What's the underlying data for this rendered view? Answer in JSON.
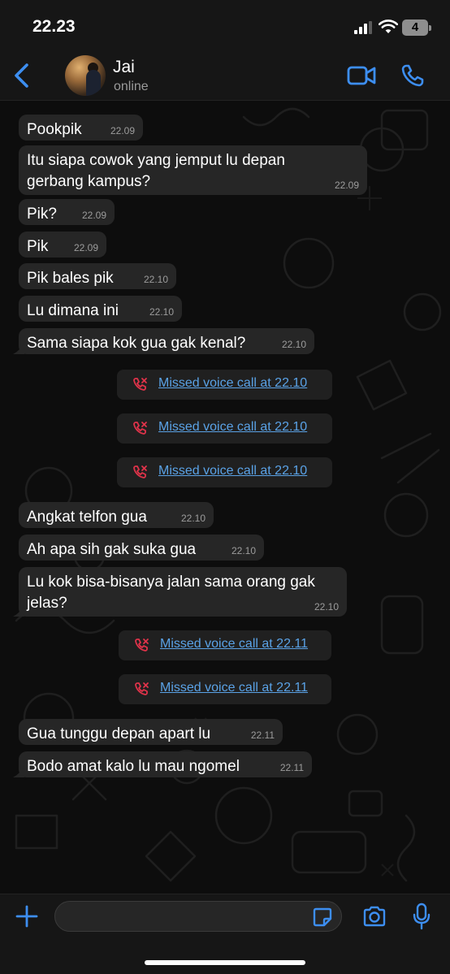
{
  "status_bar": {
    "time": "22.23",
    "battery": "4"
  },
  "header": {
    "contact_name": "Jai",
    "contact_status": "online"
  },
  "messages": [
    {
      "text": "Pookpik",
      "time": "22.09"
    },
    {
      "text": "Itu siapa cowok yang jemput lu depan\ngerbang kampus?",
      "time": "22.09"
    },
    {
      "text": "Pik?",
      "time": "22.09"
    },
    {
      "text": "Pik",
      "time": "22.09"
    },
    {
      "text": "Pik bales pik",
      "time": "22.10"
    },
    {
      "text": "Lu dimana ini",
      "time": "22.10"
    },
    {
      "text": "Sama siapa kok gua gak kenal?",
      "time": "22.10"
    },
    {
      "text": "Angkat telfon gua",
      "time": "22.10"
    },
    {
      "text": "Ah apa sih gak suka gua",
      "time": "22.10"
    },
    {
      "text": "Lu kok bisa-bisanya jalan sama orang gak\njelas?",
      "time": "22.10"
    },
    {
      "text": "Gua tunggu depan apart lu",
      "time": "22.11"
    },
    {
      "text": "Bodo amat kalo lu mau ngomel",
      "time": "22.11"
    }
  ],
  "missed_calls": [
    {
      "label": "Missed voice call at 22.10"
    },
    {
      "label": "Missed voice call at 22.10"
    },
    {
      "label": "Missed voice call at 22.10"
    },
    {
      "label": "Missed voice call at 22.11"
    },
    {
      "label": "Missed voice call at 22.11"
    }
  ],
  "input": {
    "value": "",
    "placeholder": ""
  },
  "icons": {
    "back": "chevron-left-icon",
    "video_call": "video-camera-icon",
    "voice_call": "phone-icon",
    "attach": "plus-icon",
    "sticker": "sticker-icon",
    "camera": "camera-icon",
    "mic": "microphone-icon",
    "missed_call": "missed-call-icon"
  },
  "colors": {
    "accent": "#3d8ef0",
    "link": "#5aa2e6",
    "missed_call": "#e0334a",
    "bubble": "#262626",
    "background": "#0d0d0d"
  }
}
